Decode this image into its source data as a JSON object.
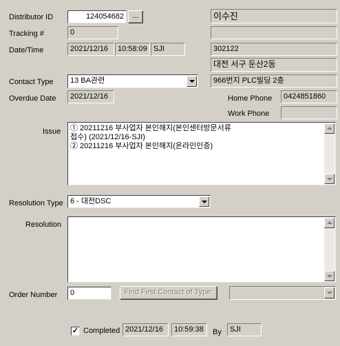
{
  "labels": {
    "distributor_id": "Distributor ID",
    "tracking": "Tracking #",
    "datetime": "Date/Time",
    "contact_type": "Contact Type",
    "overdue_date": "Overdue Date",
    "home_phone": "Home Phone",
    "work_phone": "Work Phone",
    "issue": "Issue",
    "resolution_type": "Resolution Type",
    "resolution": "Resolution",
    "order_number": "Order Number",
    "completed": "Completed",
    "by": "By"
  },
  "fields": {
    "distributor_id": "124054682",
    "lookup_button": "...",
    "tracking": "0",
    "date": "2021/12/16",
    "time": "10:58:09",
    "user": "SJI",
    "name": "이수진",
    "postal_code": "302122",
    "address1": "대전 서구 둔산2동",
    "address2": "966번지 PLC빌딩 2층",
    "contact_type": "13 BA관련",
    "overdue_date": "2021/12/16",
    "home_phone": "0424851860",
    "work_phone": "",
    "resolution_type": "6 - 대전DSC",
    "resolution": "",
    "order_number": "0",
    "find_button": "Find First Contact of Type:",
    "completed_checked": true,
    "completed_mark": "✓",
    "completed_date": "2021/12/16",
    "completed_time": "10:59:38",
    "completed_by": "SJI"
  },
  "issue_lines": [
    "① 20211216 부사업자 본인해지(본인센터방문서류",
    "접수) (2021/12/16-SJI)",
    "② 20211216 부사업자 본인해지(온라인인증)"
  ]
}
